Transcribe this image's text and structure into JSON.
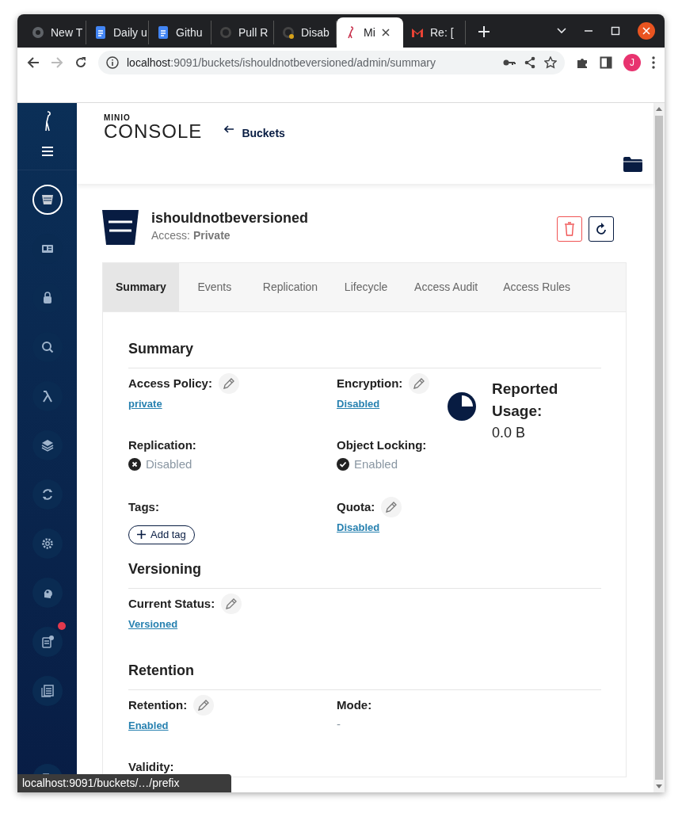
{
  "browser": {
    "tabs": [
      {
        "title": "New T",
        "selected": false
      },
      {
        "title": "Daily u",
        "selected": false
      },
      {
        "title": "Githu",
        "selected": false
      },
      {
        "title": "Pull R",
        "selected": false
      },
      {
        "title": "Disab",
        "selected": false
      },
      {
        "title": "Mi",
        "selected": true
      },
      {
        "title": "Re: [",
        "selected": false
      }
    ],
    "address": {
      "host": "localhost",
      "path": ":9091/buckets/ishouldnotbeversioned/admin/summary"
    },
    "profile": "J"
  },
  "sidebar": {
    "items": [
      {
        "selected": true,
        "alert": false
      },
      {
        "selected": false,
        "alert": false
      },
      {
        "selected": false,
        "alert": false
      },
      {
        "selected": false,
        "alert": false
      },
      {
        "selected": false,
        "alert": false
      },
      {
        "selected": false,
        "alert": false
      },
      {
        "selected": false,
        "alert": false
      },
      {
        "selected": false,
        "alert": false
      },
      {
        "selected": false,
        "alert": false
      },
      {
        "selected": false,
        "alert": true
      },
      {
        "selected": false,
        "alert": false
      }
    ]
  },
  "header": {
    "logo_top": "MINIO",
    "logo_bottom": "CONSOLE",
    "back_link": "Buckets"
  },
  "bucket": {
    "name": "ishouldnotbeversioned",
    "access": "Access: **Private**"
  },
  "tabs": [
    {
      "label": "Summary",
      "selected": true
    },
    {
      "label": "Events",
      "selected": false
    },
    {
      "label": "Replication",
      "selected": false
    },
    {
      "label": "Lifecycle",
      "selected": false
    },
    {
      "label": "Access Audit",
      "selected": false
    },
    {
      "label": "Access Rules",
      "selected": false
    }
  ],
  "sections": [
    {
      "title": "Summary",
      "fields": [
        {
          "label": "Access Policy:",
          "editable": true,
          "kind": "link",
          "value": "private"
        },
        {
          "label": "Encryption:",
          "editable": true,
          "kind": "link",
          "value": "Disabled"
        },
        {
          "label": "Replication:",
          "editable": false,
          "kind": "status",
          "enabled": false,
          "value": "Disabled"
        },
        {
          "label": "Object Locking:",
          "editable": false,
          "kind": "status",
          "enabled": true,
          "value": "Enabled"
        },
        {
          "label": "Tags:",
          "editable": false,
          "kind": "tags",
          "button": "Add tag"
        },
        {
          "label": "Quota:",
          "editable": true,
          "kind": "link",
          "value": "Disabled"
        }
      ],
      "usage": {
        "label": "Reported Usage:",
        "value": "0.0 B"
      }
    },
    {
      "title": "Versioning",
      "fields": [
        {
          "label": "Current Status:",
          "editable": true,
          "kind": "link",
          "value": "Versioned"
        }
      ]
    },
    {
      "title": "Retention",
      "fields": [
        {
          "label": "Retention:",
          "editable": true,
          "kind": "link",
          "value": "Enabled"
        },
        {
          "label": "Mode:",
          "editable": false,
          "kind": "text",
          "value": "-"
        },
        {
          "label": "Validity:",
          "editable": false,
          "kind": "text"
        }
      ]
    }
  ],
  "status_bar": "localhost:9091/buckets/…/prefix"
}
